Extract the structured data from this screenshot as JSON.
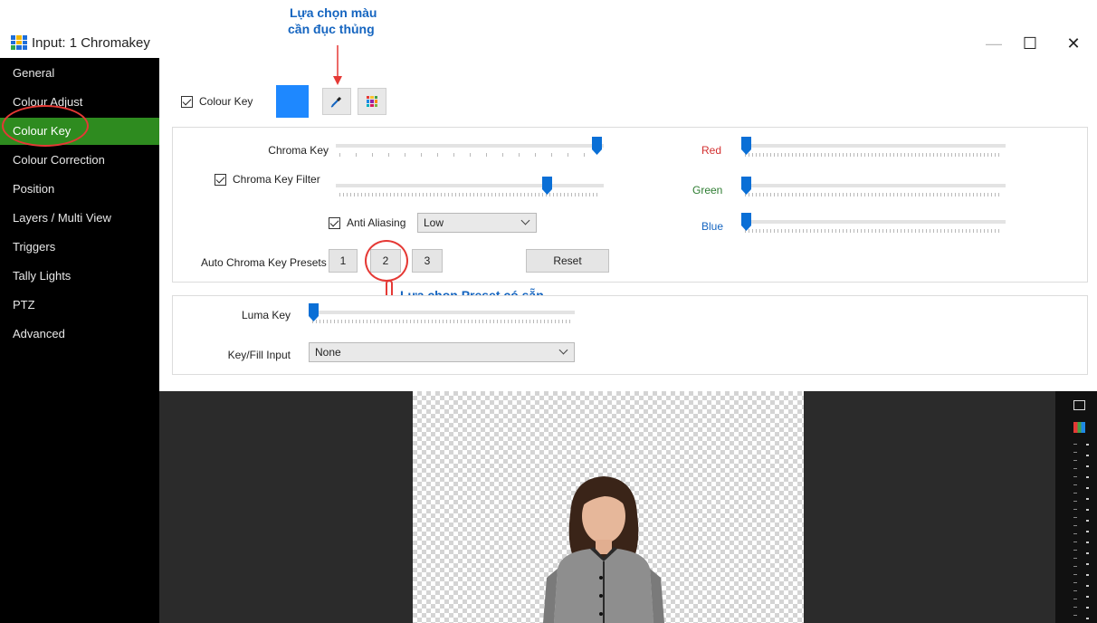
{
  "window": {
    "title": "Input: 1 Chromakey",
    "minimize_glyph": "—",
    "maximize_glyph": "☐",
    "close_glyph": "✕"
  },
  "sidebar": {
    "items": [
      {
        "label": "General"
      },
      {
        "label": "Colour Adjust"
      },
      {
        "label": "Colour Key"
      },
      {
        "label": "Colour Correction"
      },
      {
        "label": "Position"
      },
      {
        "label": "Layers / Multi View"
      },
      {
        "label": "Triggers"
      },
      {
        "label": "Tally Lights"
      },
      {
        "label": "PTZ"
      },
      {
        "label": "Advanced"
      }
    ],
    "active_index": 2
  },
  "colour_key": {
    "label": "Colour Key",
    "checked": true,
    "swatch_color": "#1e88ff"
  },
  "chroma": {
    "chroma_key_label": "Chroma Key",
    "chroma_key_value": 0.96,
    "filter_label": "Chroma Key Filter",
    "filter_checked": true,
    "filter_value": 0.78,
    "anti_aliasing_label": "Anti Aliasing",
    "anti_aliasing_checked": true,
    "anti_aliasing_value": "Low",
    "presets_label": "Auto Chroma Key Presets",
    "presets": [
      "1",
      "2",
      "3"
    ],
    "reset_label": "Reset",
    "red_label": "Red",
    "red_value": 0.0,
    "green_label": "Green",
    "green_value": 0.0,
    "blue_label": "Blue",
    "blue_value": 0.0,
    "colors": {
      "red": "#d32f2f",
      "green": "#2e7d32",
      "blue": "#1565c0"
    }
  },
  "luma": {
    "luma_key_label": "Luma Key",
    "luma_key_value": 0.0,
    "key_fill_label": "Key/Fill Input",
    "key_fill_value": "None"
  },
  "annotations": {
    "color_pick_line1": "Lựa chọn màu",
    "color_pick_line2": "cần đục thủng",
    "preset_note": "Lựa chọn Preset có sẵn"
  },
  "theme": {
    "active_green": "#2e8b1f",
    "slider_blue": "#0a6fd6",
    "annotation_blue": "#1565c0",
    "annotation_red": "#e53935"
  }
}
